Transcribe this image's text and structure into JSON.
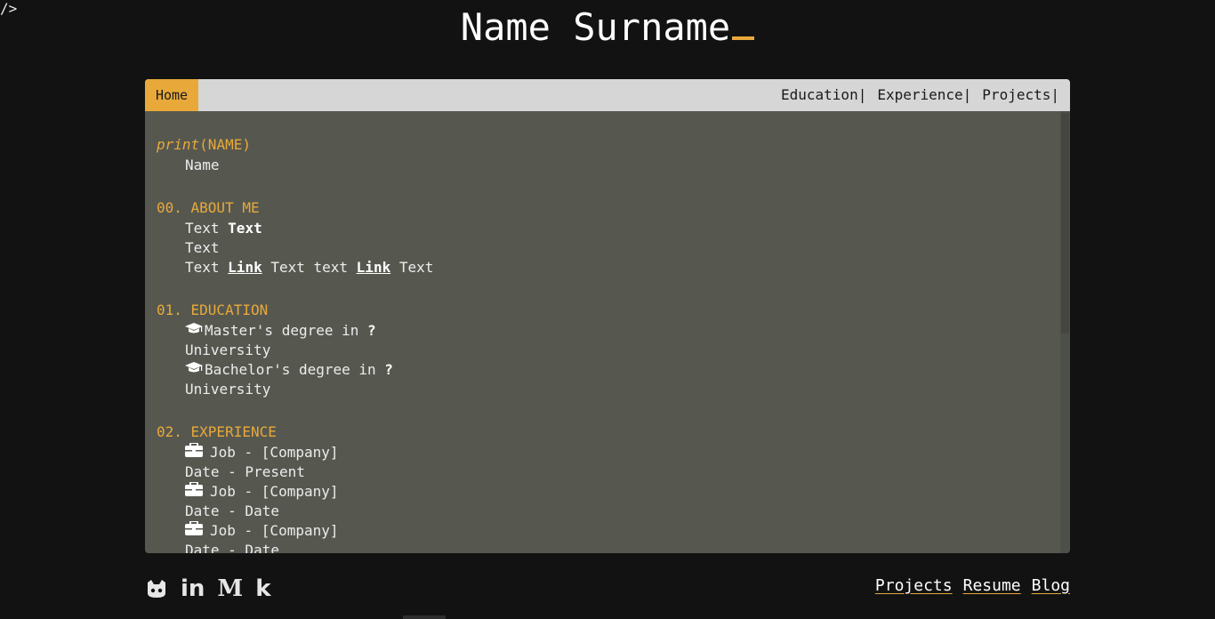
{
  "corner": {
    "logo": "/>"
  },
  "header": {
    "title": "Name Surname"
  },
  "nav": {
    "home": "Home",
    "links": [
      "Education|",
      "Experience|",
      "Projects|"
    ]
  },
  "content": {
    "print_fn": "print",
    "print_arg": "(NAME)",
    "name_value": "Name",
    "about": {
      "heading": "00. ABOUT ME",
      "line1_a": "Text ",
      "line1_b": "Text",
      "line2": "Text",
      "line3_a": "Text ",
      "line3_link1": "Link",
      "line3_b": " Text text ",
      "line3_link2": "Link",
      "line3_c": " Text"
    },
    "education": {
      "heading": "01. EDUCATION",
      "items": [
        {
          "degree": "Master's degree in ",
          "field": "?",
          "school": "University"
        },
        {
          "degree": "Bachelor's degree in ",
          "field": "?",
          "school": "University"
        }
      ]
    },
    "experience": {
      "heading": "02. EXPERIENCE",
      "items": [
        {
          "job": "Job - [Company]",
          "date": "Date - Present"
        },
        {
          "job": "Job - [Company]",
          "date": "Date - Date"
        },
        {
          "job": "Job - [Company]",
          "date": "Date - Date"
        }
      ]
    }
  },
  "icons": {
    "graduation": "graduation-cap-icon",
    "job": "briefcase-icon",
    "github": "github-icon",
    "linkedin": "linkedin-icon",
    "medium": "medium-icon",
    "kaggle": "kaggle-icon"
  },
  "footer": {
    "social": {
      "linkedin": "in",
      "medium": "M",
      "kaggle": "k"
    },
    "links": [
      "Projects",
      "Resume",
      "Blog"
    ]
  },
  "colors": {
    "accent": "#e8a93a",
    "background": "#121212",
    "panel": "#565850",
    "nav": "#d6d6d6"
  }
}
